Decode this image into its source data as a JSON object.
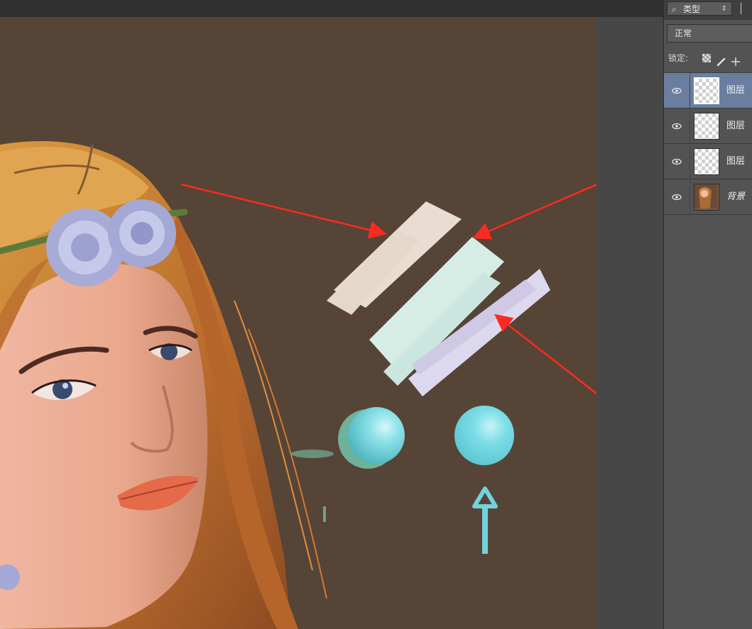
{
  "layers_panel": {
    "filter": {
      "label": "类型",
      "search_icon": "search-icon"
    },
    "blend_mode": "正常",
    "lock": {
      "label": "锁定:"
    },
    "layers": [
      {
        "name": "图层",
        "active": true,
        "thumb": "transparent-thumb"
      },
      {
        "name": "图层",
        "active": false,
        "thumb": "transparent-thumb"
      },
      {
        "name": "图层",
        "active": false,
        "thumb": "transparent-thumb"
      },
      {
        "name": "背景",
        "active": false,
        "thumb": "portrait-thumb"
      }
    ]
  },
  "canvas": {
    "background": "#564436",
    "swatch_colors": [
      "#ece2d6",
      "#d6ede6",
      "#dcd8ee"
    ],
    "annotation_color": "#ff2a1f",
    "bead_colors": [
      "#7cdde6",
      "#6fb19a"
    ]
  }
}
